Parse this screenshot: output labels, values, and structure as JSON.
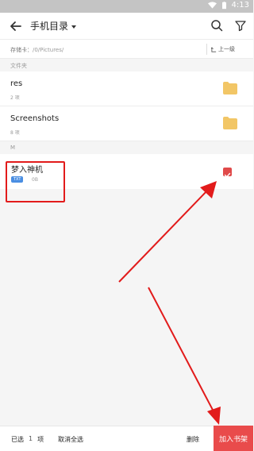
{
  "status_bar": {
    "time": "4:13"
  },
  "header": {
    "title": "手机目录"
  },
  "path_bar": {
    "label": "存储卡：",
    "path": "/0/Pictures/",
    "up_label": "上一级"
  },
  "sections": {
    "folders_label": "文件夹",
    "m_label": "M"
  },
  "folders": [
    {
      "name": "res",
      "count": "2 项"
    },
    {
      "name": "Screenshots",
      "count": "8 项"
    }
  ],
  "file": {
    "name": "梦入神机",
    "type": "TXT",
    "size": "0B",
    "checked": true
  },
  "bottom_bar": {
    "selected_prefix": "已选",
    "selected_count": "1",
    "selected_suffix": "项",
    "deselect_all": "取消全选",
    "delete": "删除",
    "add_to_shelf": "加入书架"
  },
  "colors": {
    "accent": "#e94b4b",
    "badge": "#4a8ee2",
    "folder": "#f2c666",
    "annotation": "#e21b1b"
  }
}
